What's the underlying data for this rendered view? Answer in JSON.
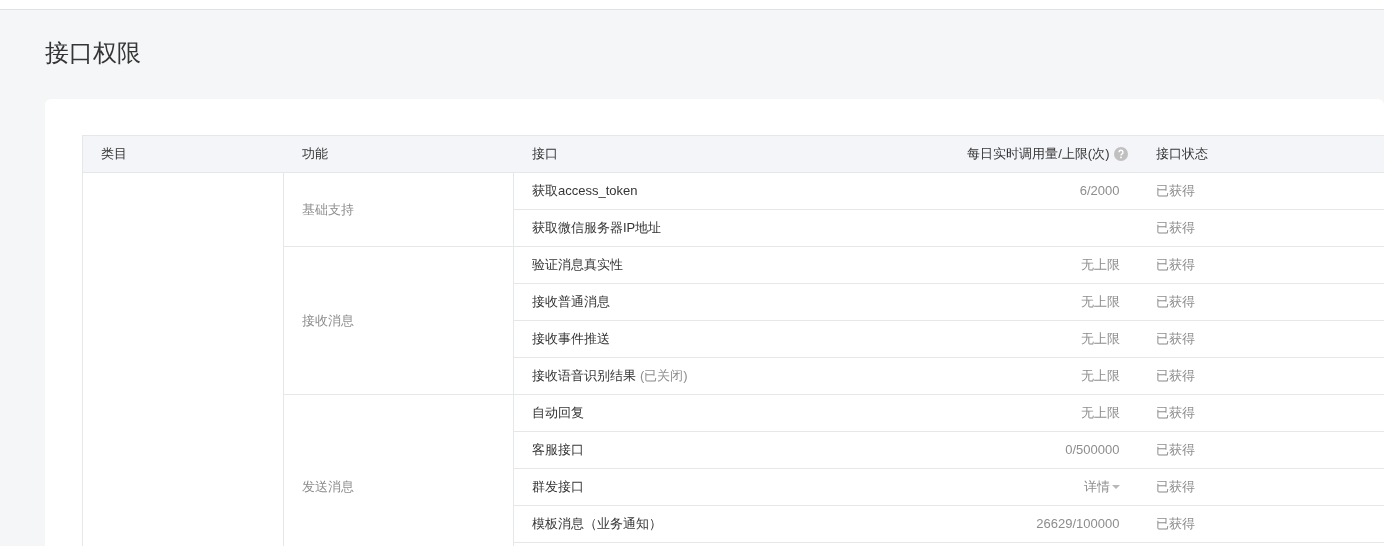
{
  "title": "接口权限",
  "table": {
    "columns": [
      "类目",
      "功能",
      "接口",
      "每日实时调用量/上限(次)",
      "接口状态"
    ],
    "groups": [
      {
        "function": "基础支持",
        "rows": [
          {
            "interface": "获取access_token",
            "quota": "6/2000",
            "status": "已获得"
          },
          {
            "interface": "获取微信服务器IP地址",
            "status": "已获得"
          }
        ]
      },
      {
        "function": "接收消息",
        "rows": [
          {
            "interface": "验证消息真实性",
            "quota": "无上限",
            "status": "已获得"
          },
          {
            "interface": "接收普通消息",
            "quota": "无上限",
            "status": "已获得"
          },
          {
            "interface": "接收事件推送",
            "quota": "无上限",
            "status": "已获得"
          },
          {
            "interface": "接收语音识别结果",
            "note": "(已关闭)",
            "quota": "无上限",
            "status": "已获得"
          }
        ]
      },
      {
        "function": "发送消息",
        "rows": [
          {
            "interface": "自动回复",
            "quota": "无上限",
            "status": "已获得"
          },
          {
            "interface": "客服接口",
            "quota": "0/500000",
            "status": "已获得"
          },
          {
            "interface": "群发接口",
            "quota": "详情",
            "kind": "dropdown",
            "status": "已获得"
          },
          {
            "interface": "模板消息（业务通知）",
            "quota": "26629/100000",
            "status": "已获得"
          }
        ]
      }
    ]
  }
}
